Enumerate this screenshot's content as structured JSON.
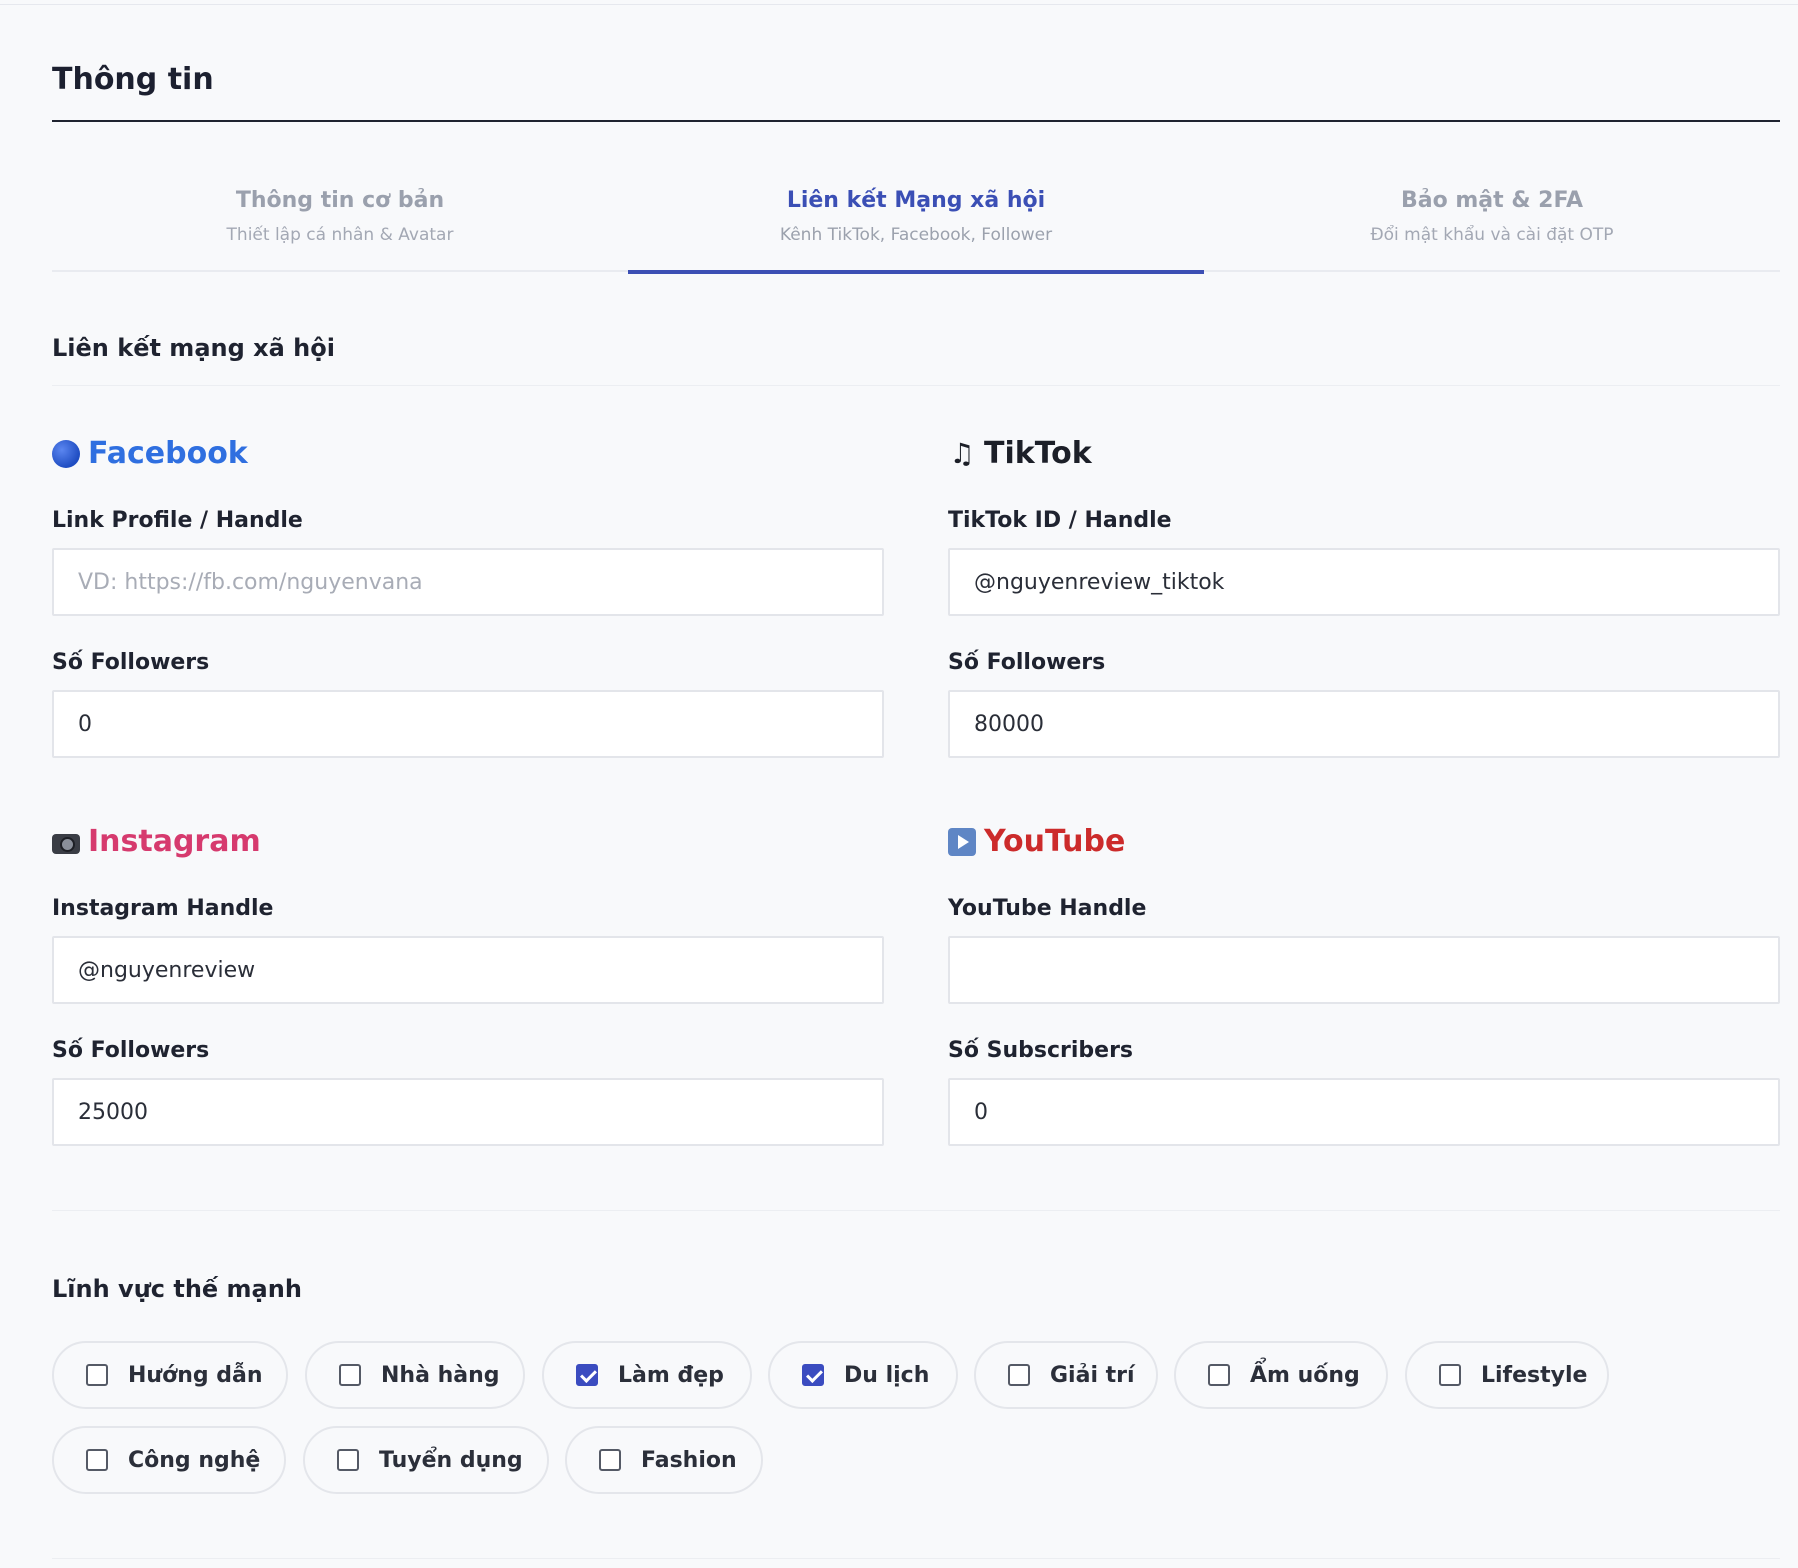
{
  "page": {
    "title": "Thông tin"
  },
  "tabs": [
    {
      "title": "Thông tin cơ bản",
      "subtitle": "Thiết lập cá nhân & Avatar",
      "active": false
    },
    {
      "title": "Liên kết Mạng xã hội",
      "subtitle": "Kênh TikTok, Facebook, Follower",
      "active": true
    },
    {
      "title": "Bảo mật & 2FA",
      "subtitle": "Đổi mật khẩu và cài đặt OTP",
      "active": false
    }
  ],
  "social": {
    "section_title": "Liên kết mạng xã hội",
    "facebook": {
      "name": "Facebook",
      "icon": "blue-circle-icon",
      "color": "#2f6fe0",
      "handle_label": "Link Profile / Handle",
      "handle_value": "",
      "handle_placeholder": "VD: https://fb.com/nguyenvana",
      "count_label": "Số Followers",
      "count_value": "0"
    },
    "tiktok": {
      "name": "TikTok",
      "icon": "music-note-icon",
      "color": "#1c1f28",
      "handle_label": "TikTok ID / Handle",
      "handle_value": "@nguyenreview_tiktok",
      "count_label": "Số Followers",
      "count_value": "80000"
    },
    "instagram": {
      "name": "Instagram",
      "icon": "camera-icon",
      "color": "#d63a6e",
      "handle_label": "Instagram Handle",
      "handle_value": "@nguyenreview",
      "count_label": "Số Followers",
      "count_value": "25000"
    },
    "youtube": {
      "name": "YouTube",
      "icon": "play-button-icon",
      "color": "#cc2b2b",
      "handle_label": "YouTube Handle",
      "handle_value": "",
      "count_label": "Số Subscribers",
      "count_value": "0"
    }
  },
  "fields": {
    "title": "Lĩnh vực thế mạnh",
    "options": [
      {
        "label": "Hướng dẫn",
        "checked": false
      },
      {
        "label": "Nhà hàng",
        "checked": false
      },
      {
        "label": "Làm đẹp",
        "checked": true
      },
      {
        "label": "Du lịch",
        "checked": true
      },
      {
        "label": "Giải trí",
        "checked": false
      },
      {
        "label": "Ẩm uống",
        "checked": false
      },
      {
        "label": "Lifestyle",
        "checked": false
      },
      {
        "label": "Công nghệ",
        "checked": false
      },
      {
        "label": "Tuyển dụng",
        "checked": false
      },
      {
        "label": "Fashion",
        "checked": false
      }
    ]
  },
  "colors": {
    "accent": "#3c4fb4",
    "checkbox_on": "#3b4cc0"
  }
}
